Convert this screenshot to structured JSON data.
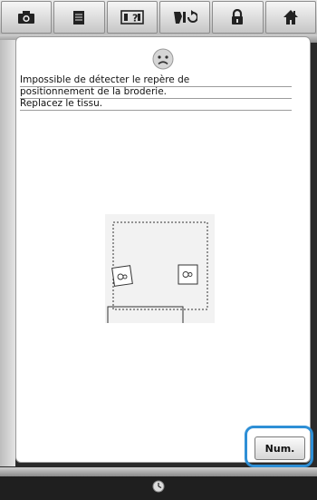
{
  "toolbar": {
    "buttons": [
      {
        "name": "camera-icon"
      },
      {
        "name": "document-icon"
      },
      {
        "name": "help-icon"
      },
      {
        "name": "thread-change-icon"
      },
      {
        "name": "lock-icon"
      },
      {
        "name": "home-icon"
      }
    ]
  },
  "message": {
    "icon": "sad-face-icon",
    "line1": "Impossible de détecter le repère de",
    "line2": "positionnement de la broderie.",
    "line3": "Replacez le tissu."
  },
  "actions": {
    "num_label": "Num.",
    "highlight_color": "#2e8fd6"
  },
  "footer": {
    "icon": "clock-icon"
  }
}
